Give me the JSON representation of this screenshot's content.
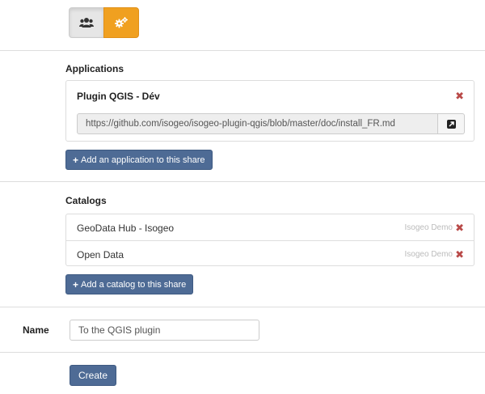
{
  "toggle": {
    "users_icon": "users-icon",
    "apps_icon": "gears-icon",
    "active": "applications",
    "active_color": "#f0a020"
  },
  "applications": {
    "heading": "Applications",
    "items": [
      {
        "name": "Plugin QGIS - Dév",
        "url": "https://github.com/isogeo/isogeo-plugin-qgis/blob/master/doc/install_FR.md"
      }
    ],
    "add_label": "Add an application to this share"
  },
  "catalogs": {
    "heading": "Catalogs",
    "items": [
      {
        "name": "GeoData Hub - Isogeo",
        "owner": "Isogeo Demo"
      },
      {
        "name": "Open Data",
        "owner": "Isogeo Demo"
      }
    ],
    "add_label": "Add a catalog to this share"
  },
  "form": {
    "name_label": "Name",
    "name_value": "To the QGIS plugin",
    "create_label": "Create"
  },
  "colors": {
    "primary": "#4e6b95",
    "danger": "#b94a48",
    "accent": "#f0a020"
  }
}
